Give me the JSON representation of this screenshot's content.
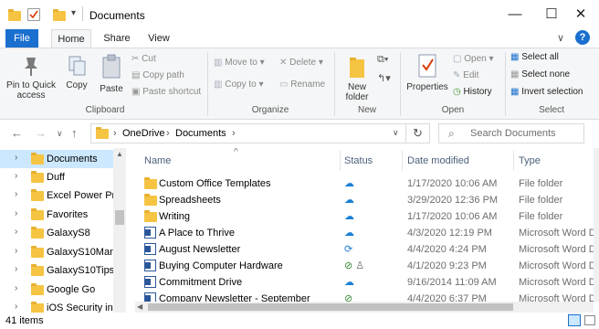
{
  "window": {
    "title": "Documents",
    "minimize": "—",
    "maximize": "☐",
    "close": "✕"
  },
  "ribbon_tabs": [
    "File",
    "Home",
    "Share",
    "View"
  ],
  "ribbon": {
    "clipboard": {
      "pin": "Pin to Quick access",
      "copy": "Copy",
      "paste": "Paste",
      "cut": "Cut",
      "copy_path": "Copy path",
      "paste_shortcut": "Paste shortcut",
      "label": "Clipboard"
    },
    "organize": {
      "move_to": "Move to",
      "copy_to": "Copy to",
      "delete": "Delete",
      "rename": "Rename",
      "label": "Organize"
    },
    "new": {
      "new_folder": "New folder",
      "label": "New"
    },
    "open": {
      "properties": "Properties",
      "open": "Open",
      "edit": "Edit",
      "history": "History",
      "label": "Open"
    },
    "select": {
      "select_all": "Select all",
      "select_none": "Select none",
      "invert": "Invert selection",
      "label": "Select"
    }
  },
  "address": {
    "crumbs": [
      "OneDrive",
      "Documents"
    ],
    "search_placeholder": "Search Documents"
  },
  "nav_items": [
    {
      "label": "Documents",
      "selected": true
    },
    {
      "label": "Duff"
    },
    {
      "label": "Excel Power Pro"
    },
    {
      "label": "Favorites"
    },
    {
      "label": "GalaxyS8"
    },
    {
      "label": "GalaxyS10Mania"
    },
    {
      "label": "GalaxyS10Tips"
    },
    {
      "label": "Google Go"
    },
    {
      "label": "iOS Security in E"
    }
  ],
  "columns": {
    "name": "Name",
    "status": "Status",
    "date": "Date modified",
    "type": "Type"
  },
  "files": [
    {
      "name": "Custom Office Templates",
      "kind": "folder",
      "status": "cloud",
      "date": "1/17/2020 10:06 AM",
      "type": "File folder"
    },
    {
      "name": "Spreadsheets",
      "kind": "folder",
      "status": "cloud",
      "date": "3/29/2020 12:36 PM",
      "type": "File folder"
    },
    {
      "name": "Writing",
      "kind": "folder",
      "status": "cloud",
      "date": "1/17/2020 10:06 AM",
      "type": "File folder"
    },
    {
      "name": "A Place to Thrive",
      "kind": "doc",
      "status": "cloud",
      "date": "4/3/2020 12:19 PM",
      "type": "Microsoft Word D"
    },
    {
      "name": "August Newsletter",
      "kind": "doc",
      "status": "sync",
      "date": "4/4/2020 4:24 PM",
      "type": "Microsoft Word D"
    },
    {
      "name": "Buying Computer Hardware",
      "kind": "doc",
      "status": "shared",
      "date": "4/1/2020 9:23 PM",
      "type": "Microsoft Word D"
    },
    {
      "name": "Commitment Drive",
      "kind": "doc",
      "status": "cloud",
      "date": "9/16/2014 11:09 AM",
      "type": "Microsoft Word D"
    },
    {
      "name": "Company Newsletter - September",
      "kind": "doc",
      "status": "local",
      "date": "4/4/2020 6:37 PM",
      "type": "Microsoft Word D"
    }
  ],
  "status_bar": {
    "count": "41 items"
  },
  "colors": {
    "accent": "#1a6fcf",
    "selection": "#cce8ff",
    "folder": "#f6c443"
  }
}
